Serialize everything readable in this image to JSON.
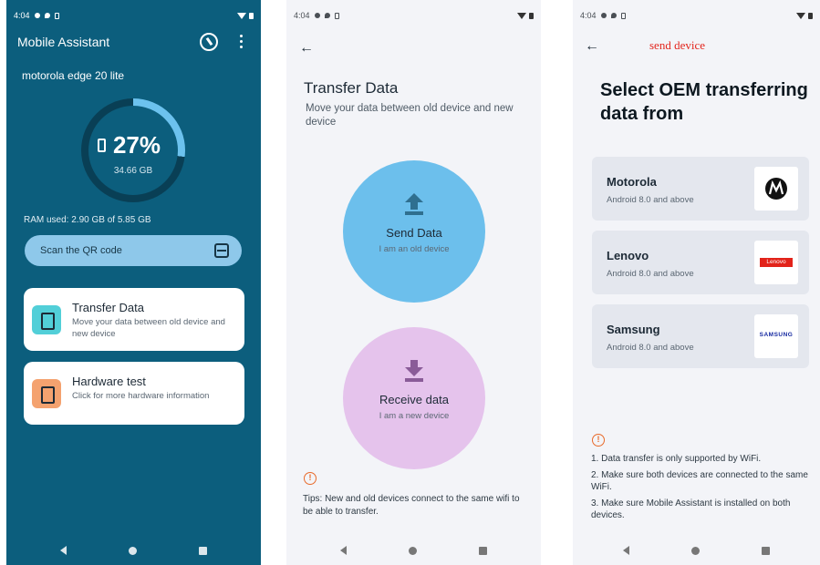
{
  "status_bar": {
    "time": "4:04"
  },
  "screen1": {
    "app_title": "Mobile Assistant",
    "device_name": "motorola edge 20 lite",
    "storage_percent": "27%",
    "storage_used": "34.66 GB",
    "storage_fraction": 0.27,
    "ram_used": "RAM used: 2.90 GB of 5.85 GB",
    "scan_button": "Scan the QR code",
    "cards": [
      {
        "title": "Transfer Data",
        "desc": "Move your data between old device and new device"
      },
      {
        "title": "Hardware test",
        "desc": "Click for more hardware information"
      }
    ]
  },
  "screen2": {
    "title": "Transfer Data",
    "subtitle": "Move your data between old device and new device",
    "send": {
      "label": "Send Data",
      "sub": "I am an old device"
    },
    "receive": {
      "label": "Receive data",
      "sub": "I am a new device"
    },
    "tips": "Tips: New and old devices connect to the same wifi to be able to transfer."
  },
  "screen3": {
    "header_label": "send device",
    "title": "Select OEM transferring data from",
    "oems": [
      {
        "name": "Motorola",
        "version": "Android 8.0 and above",
        "logo": "motorola-logo"
      },
      {
        "name": "Lenovo",
        "version": "Android 8.0 and above",
        "logo_text": "Lenovo"
      },
      {
        "name": "Samsung",
        "version": "Android 8.0 and above",
        "logo_text": "SAMSUNG"
      }
    ],
    "notes": [
      "1. Data transfer is only supported by WiFi.",
      "2. Make sure both devices are connected to the same WiFi.",
      "3. Make sure Mobile Assistant is installed on both devices."
    ]
  },
  "colors": {
    "teal_bg": "#0c5e7d",
    "send_circle": "#6cbfec",
    "receive_circle": "#e5c3ec",
    "warning": "#e86a2a"
  }
}
